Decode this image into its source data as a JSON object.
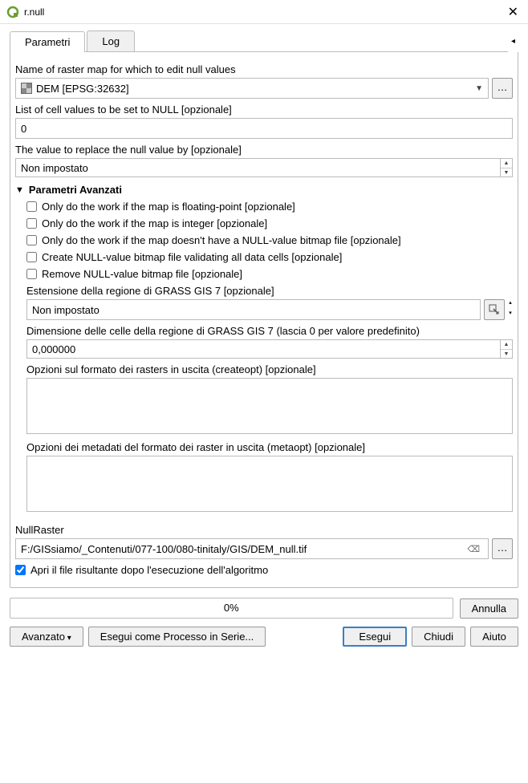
{
  "window": {
    "title": "r.null"
  },
  "tabs": {
    "parameters": "Parametri",
    "log": "Log"
  },
  "fields": {
    "raster_label": "Name of raster map for which to edit null values",
    "raster_value": "DEM [EPSG:32632]",
    "null_list_label": "List of cell values to be set to NULL [opzionale]",
    "null_list_value": "0",
    "replace_label": "The value to replace the null value by [opzionale]",
    "replace_value": "Non impostato"
  },
  "advanced": {
    "header": "Parametri Avanzati",
    "chk_float": "Only do the work if the map is floating-point [opzionale]",
    "chk_integer": "Only do the work if the map is integer [opzionale]",
    "chk_no_bitmap": "Only do the work if the map doesn't have a NULL-value bitmap file [opzionale]",
    "chk_create_bitmap": "Create NULL-value bitmap file validating all data cells [opzionale]",
    "chk_remove_bitmap": "Remove NULL-value bitmap file [opzionale]",
    "region_ext_label": "Estensione della regione di GRASS GIS 7 [opzionale]",
    "region_ext_value": "Non impostato",
    "cell_size_label": "Dimensione delle celle della regione di GRASS GIS 7 (lascia 0 per valore predefinito)",
    "cell_size_value": "0,000000",
    "createopt_label": "Opzioni sul formato dei rasters in uscita (createopt) [opzionale]",
    "metaopt_label": "Opzioni dei metadati del formato dei raster in uscita (metaopt) [opzionale]"
  },
  "output": {
    "label": "NullRaster",
    "path": "F:/GISsiamo/_Contenuti/077-100/080-tinitaly/GIS/DEM_null.tif",
    "open_after": "Apri il file risultante dopo l'esecuzione dell'algoritmo"
  },
  "progress": {
    "text": "0%"
  },
  "buttons": {
    "cancel": "Annulla",
    "advanced": "Avanzato",
    "batch": "Esegui come Processo in Serie...",
    "run": "Esegui",
    "close": "Chiudi",
    "help": "Aiuto"
  }
}
